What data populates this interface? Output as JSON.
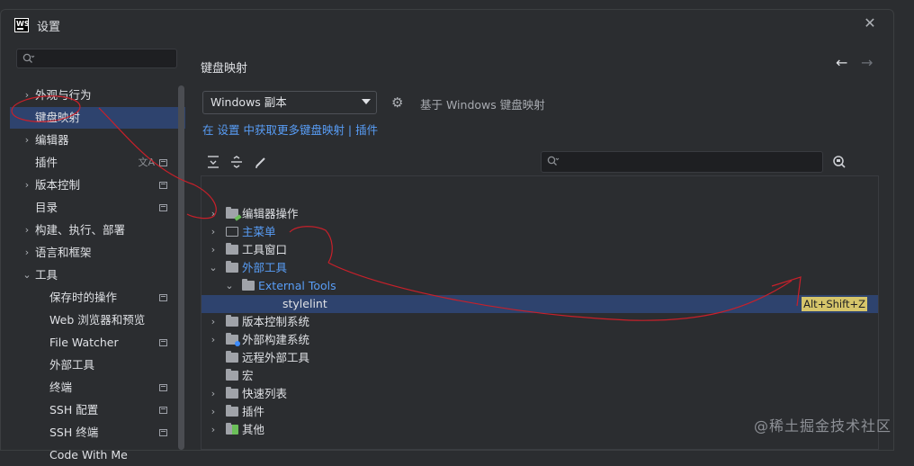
{
  "window": {
    "title": "设置",
    "app_logo": "WS"
  },
  "sidebar": {
    "search_placeholder": "",
    "items": [
      {
        "label": "外观与行为",
        "arrow": "›",
        "indent": 0,
        "selected": false
      },
      {
        "label": "键盘映射",
        "arrow": "",
        "indent": 0,
        "selected": true
      },
      {
        "label": "编辑器",
        "arrow": "›",
        "indent": 0,
        "selected": false
      },
      {
        "label": "插件",
        "arrow": "",
        "indent": 0,
        "selected": false,
        "lang_icon": "文A",
        "mini": true
      },
      {
        "label": "版本控制",
        "arrow": "›",
        "indent": 0,
        "selected": false,
        "mini": true
      },
      {
        "label": "目录",
        "arrow": "",
        "indent": 0,
        "selected": false,
        "mini": true
      },
      {
        "label": "构建、执行、部署",
        "arrow": "›",
        "indent": 0,
        "selected": false
      },
      {
        "label": "语言和框架",
        "arrow": "›",
        "indent": 0,
        "selected": false
      },
      {
        "label": "工具",
        "arrow": "⌄",
        "indent": 0,
        "selected": false
      },
      {
        "label": "保存时的操作",
        "arrow": "",
        "indent": 1,
        "selected": false,
        "mini": true
      },
      {
        "label": "Web 浏览器和预览",
        "arrow": "",
        "indent": 1,
        "selected": false
      },
      {
        "label": "File Watcher",
        "arrow": "",
        "indent": 1,
        "selected": false,
        "mini": true
      },
      {
        "label": "外部工具",
        "arrow": "",
        "indent": 1,
        "selected": false
      },
      {
        "label": "终端",
        "arrow": "",
        "indent": 1,
        "selected": false,
        "mini": true
      },
      {
        "label": "SSH 配置",
        "arrow": "",
        "indent": 1,
        "selected": false,
        "mini": true
      },
      {
        "label": "SSH 终端",
        "arrow": "",
        "indent": 1,
        "selected": false,
        "mini": true
      },
      {
        "label": "Code With Me",
        "arrow": "",
        "indent": 1,
        "selected": false
      }
    ]
  },
  "main": {
    "title": "键盘映射",
    "keymap_selected": "Windows 副本",
    "based_on": "基于 Windows 键盘映射",
    "link_prefix": "在 设置 中获取更多键盘映射 | ",
    "link_plugins": "插件",
    "filter_placeholder": "",
    "tree": [
      {
        "label": "编辑器操作",
        "arrow": "›",
        "level": 0,
        "folder": "edit",
        "blue": false
      },
      {
        "label": "主菜单",
        "arrow": "›",
        "level": 0,
        "folder": "menu",
        "blue": true
      },
      {
        "label": "工具窗口",
        "arrow": "›",
        "level": 0,
        "folder": "plain",
        "blue": false
      },
      {
        "label": "外部工具",
        "arrow": "⌄",
        "level": 0,
        "folder": "plain",
        "blue": true
      },
      {
        "label": "External Tools",
        "arrow": "⌄",
        "level": 1,
        "folder": "plain",
        "blue": true
      },
      {
        "label": "stylelint",
        "arrow": "",
        "level": 2,
        "folder": "none",
        "blue": false,
        "selected": true,
        "shortcut": "Alt+Shift+Z"
      },
      {
        "label": "版本控制系统",
        "arrow": "›",
        "level": 0,
        "folder": "plain",
        "blue": false
      },
      {
        "label": "外部构建系统",
        "arrow": "›",
        "level": 0,
        "folder": "badge",
        "blue": false
      },
      {
        "label": "远程外部工具",
        "arrow": "",
        "level": 0,
        "folder": "plain",
        "blue": false
      },
      {
        "label": "宏",
        "arrow": "",
        "level": 0,
        "folder": "plain",
        "blue": false
      },
      {
        "label": "快速列表",
        "arrow": "›",
        "level": 0,
        "folder": "plain",
        "blue": false
      },
      {
        "label": "插件",
        "arrow": "›",
        "level": 0,
        "folder": "plain",
        "blue": false
      },
      {
        "label": "其他",
        "arrow": "›",
        "level": 0,
        "folder": "gridish",
        "blue": false
      }
    ]
  },
  "watermark": "@稀土掘金技术社区",
  "colors": {
    "accent": "#2e436e",
    "link": "#589df6",
    "shortcut_bg": "#d6c56a",
    "annotation": "#c8202a"
  }
}
